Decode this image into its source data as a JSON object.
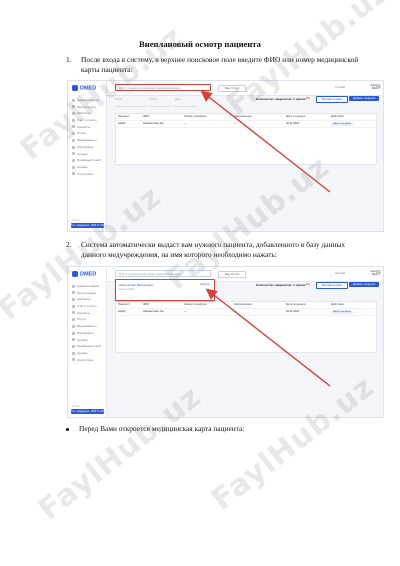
{
  "heading": "Внеплановый осмотр пациента",
  "steps": [
    {
      "num": "1.",
      "text": "После входа в систему, в верхнее поисковое поле введите ФИО или номер медицинской карты пациента:"
    },
    {
      "num": "2.",
      "text": "Система автоматически выдаст вам нужного пациента, добавленного в базу данных данного медучреждения, на имя которого необходимо нажать:"
    }
  ],
  "bullet": "Перед Вами откроется медицинская карта пациента:",
  "watermark": "FaylHub.uz",
  "screens": {
    "logo": "DMED",
    "menu": [
      "Администрация",
      "Регистратура",
      "Кабинеты",
      "Учёт и отчёты",
      "Контакты",
      "Услуги",
      "Медикаменты",
      "Расписание",
      "Склады",
      "Приёмный покой",
      "Архивы",
      "Статистика"
    ],
    "search_placeholder": "Ф.И.О. пациента или номер медицинской карты",
    "nav_button": "Мед. Услуги",
    "lang": "Русский",
    "user_name": "Admin",
    "user_role": "Врач",
    "quota": "Количество пациентов: 1 прием",
    "badge": "2/3",
    "outline_button": "Внешние вызовы",
    "primary_button": "Добавить пациента",
    "filters": [
      "Поиск",
      "Статус",
      "Дата",
      "Начало",
      "Конец",
      "Тип приёма",
      "Врач"
    ],
    "columns": [
      "Пациент",
      "ФИО",
      "Номер телефона",
      "Направление",
      "Дата создания",
      "Действия"
    ],
    "row": [
      "Арабх",
      "Амонов Гаёс Ам.",
      "—",
      "—",
      "26.11.2021",
      "Запись на приём"
    ],
    "result_name": "Амонов Гаёс Фарходович",
    "result_card": "Карта №0001",
    "result_link": "Открыть",
    "footer": "Тех. поддержка: +998 71 200-00-00",
    "version": "v1.0.0"
  }
}
